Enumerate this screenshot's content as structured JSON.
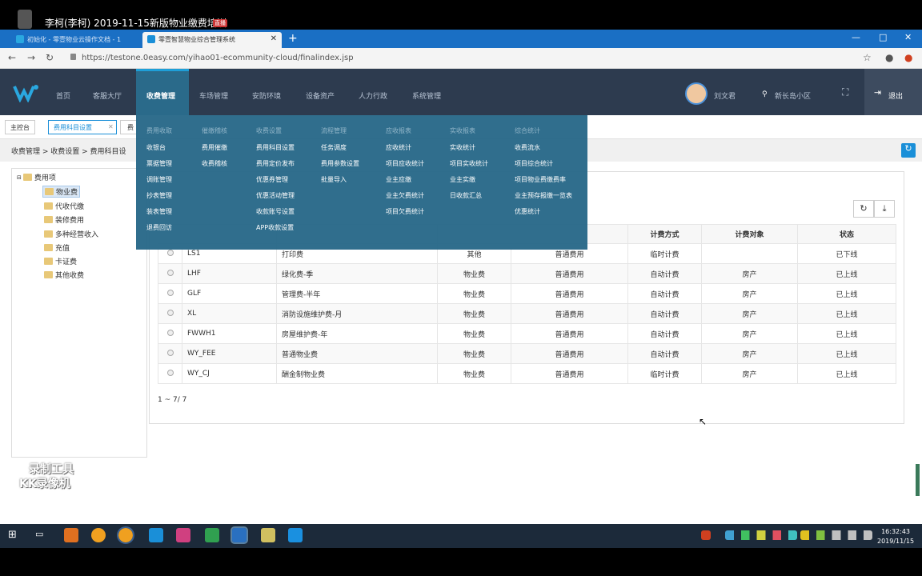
{
  "recorder": {
    "title": "李柯(李柯) 2019-11-15新版物业缴费培训",
    "badge": "直播"
  },
  "browser": {
    "tabs": [
      {
        "label": "初始化 - 零壹物业云操作文档 - 1"
      },
      {
        "label": "零壹智慧物业综合管理系统"
      }
    ],
    "new_tab": "+",
    "url": "https://testone.0easy.com/yihao01-ecommunity-cloud/finalindex.jsp",
    "min": "—",
    "max": "□",
    "close": "✕"
  },
  "topnav": {
    "items": [
      "首页",
      "客服大厅",
      "收费管理",
      "车场管理",
      "安防环境",
      "设备资产",
      "人力行政",
      "系统管理"
    ],
    "user": "刘文君",
    "community": "新长岛小区",
    "logout": "退出"
  },
  "page_tabs": [
    "主控台",
    "费用科目设置",
    "费"
  ],
  "page_tab_close": "✕",
  "breadcrumb": "收费管理 > 收费设置 > 费用科目设",
  "tree": {
    "root": "费用项",
    "children": [
      "物业费",
      "代收代缴",
      "装修费用",
      "多种经营收入",
      "充值",
      "卡证费",
      "其他收费"
    ]
  },
  "watermark": {
    "line1": "录制工具",
    "line2": "KK录像机"
  },
  "table": {
    "visible_headers": [
      "计费方式",
      "计费对象",
      "状态"
    ],
    "rows": [
      {
        "code": "LS1",
        "name": "打印费",
        "cat": "其他",
        "type": "普通费用",
        "method": "临时计费",
        "target": "",
        "status": "已下线"
      },
      {
        "code": "LHF",
        "name": "绿化费-季",
        "cat": "物业费",
        "type": "普通费用",
        "method": "自动计费",
        "target": "房产",
        "status": "已上线"
      },
      {
        "code": "GLF",
        "name": "管理费-半年",
        "cat": "物业费",
        "type": "普通费用",
        "method": "自动计费",
        "target": "房产",
        "status": "已上线"
      },
      {
        "code": "XL",
        "name": "消防设施维护费-月",
        "cat": "物业费",
        "type": "普通费用",
        "method": "自动计费",
        "target": "房产",
        "status": "已上线"
      },
      {
        "code": "FWWH1",
        "name": "房屋维护费-年",
        "cat": "物业费",
        "type": "普通费用",
        "method": "自动计费",
        "target": "房产",
        "status": "已上线"
      },
      {
        "code": "WY_FEE",
        "name": "普通物业费",
        "cat": "物业费",
        "type": "普通费用",
        "method": "自动计费",
        "target": "房产",
        "status": "已上线"
      },
      {
        "code": "WY_CJ",
        "name": "酬金制物业费",
        "cat": "物业费",
        "type": "普通费用",
        "method": "临时计费",
        "target": "房产",
        "status": "已上线"
      }
    ],
    "pager": "1 ~ 7/ 7"
  },
  "megamenu": {
    "columns": [
      {
        "head": "费用收取",
        "items": [
          "收银台",
          "票据管理",
          "调账管理",
          "抄表管理",
          "装表管理",
          "退费回访"
        ]
      },
      {
        "head": "催缴稽核",
        "items": [
          "费用催缴",
          "收费稽核"
        ]
      },
      {
        "head": "收费设置",
        "items": [
          "费用科目设置",
          "费用定价发布",
          "优惠券管理",
          "优惠活动管理",
          "收款账号设置",
          "APP收款设置"
        ]
      },
      {
        "head": "流程管理",
        "items": [
          "任务调度",
          "费用参数设置",
          "批量导入"
        ]
      },
      {
        "head": "应收报表",
        "items": [
          "应收统计",
          "项目应收统计",
          "业主应缴",
          "业主欠费统计",
          "项目欠费统计"
        ]
      },
      {
        "head": "实收报表",
        "items": [
          "实收统计",
          "项目实收统计",
          "业主实缴",
          "日收款汇总"
        ]
      },
      {
        "head": "综合统计",
        "items": [
          "收费流水",
          "项目综合统计",
          "项目物业费缴费率",
          "业主预存报缴一览表",
          "优惠统计"
        ]
      }
    ]
  },
  "taskbar": {
    "time": "16:32:43",
    "date": "2019/11/15"
  },
  "colors": {
    "nav_bg": "#2d3b4f",
    "menu_bg": "#2a6a8a",
    "accent": "#1a8fd8",
    "tabbar": "#1a6fc4"
  }
}
